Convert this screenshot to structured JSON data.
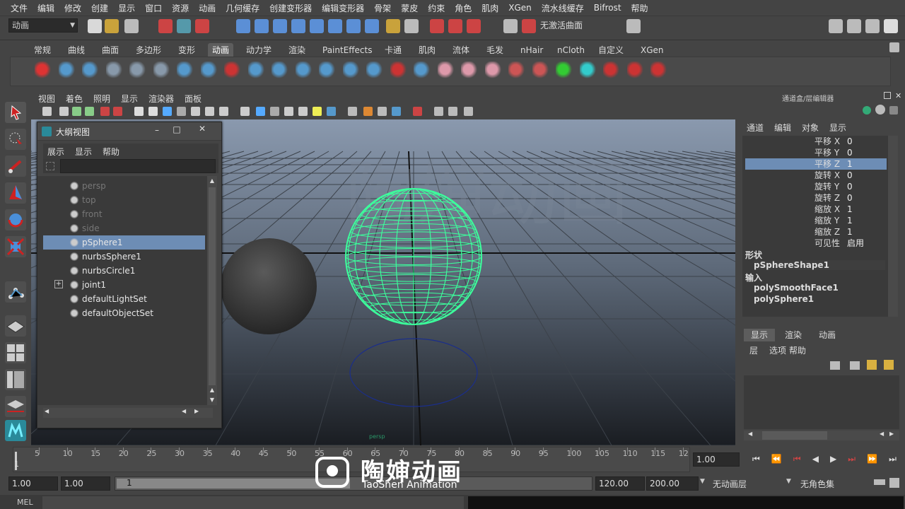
{
  "menubar": [
    "文件",
    "编辑",
    "修改",
    "创建",
    "显示",
    "窗口",
    "资源",
    "动画",
    "几何缓存",
    "创建变形器",
    "编辑变形器",
    "骨架",
    "蒙皮",
    "约束",
    "角色",
    "肌肉",
    "XGen",
    "流水线缓存",
    "Bifrost",
    "帮助"
  ],
  "status": {
    "mode": "动画",
    "live_surface": "无激活曲面"
  },
  "shelf_tabs": [
    "常规",
    "曲线",
    "曲面",
    "多边形",
    "变形",
    "动画",
    "动力学",
    "渲染",
    "PaintEffects",
    "卡通",
    "肌肉",
    "流体",
    "毛发",
    "nHair",
    "nCloth",
    "自定义",
    "XGen"
  ],
  "shelf_active": "动画",
  "viewport": {
    "menus": [
      "视图",
      "着色",
      "照明",
      "显示",
      "渲染器",
      "面板"
    ],
    "camera_label": "persp",
    "watermark": "陶婶动画"
  },
  "outliner": {
    "title": "大纲视图",
    "menus": [
      "展示",
      "显示",
      "帮助"
    ],
    "items": [
      {
        "name": "persp",
        "icon": "camera-icon",
        "dim": true
      },
      {
        "name": "top",
        "icon": "camera-icon",
        "dim": true
      },
      {
        "name": "front",
        "icon": "camera-icon",
        "dim": true
      },
      {
        "name": "side",
        "icon": "camera-icon",
        "dim": true
      },
      {
        "name": "pSphere1",
        "icon": "poly-mesh-icon",
        "selected": true
      },
      {
        "name": "nurbsSphere1",
        "icon": "nurbs-surface-icon"
      },
      {
        "name": "nurbsCircle1",
        "icon": "nurbs-curve-icon"
      },
      {
        "name": "joint1",
        "icon": "joint-icon",
        "expandable": true
      },
      {
        "name": "defaultLightSet",
        "icon": "set-icon"
      },
      {
        "name": "defaultObjectSet",
        "icon": "set-icon"
      }
    ]
  },
  "channel_box": {
    "title": "通道盒/层编辑器",
    "menus": [
      "通道",
      "编辑",
      "对象",
      "显示"
    ],
    "attributes": [
      {
        "name": "平移 X",
        "value": "0"
      },
      {
        "name": "平移 Y",
        "value": "0"
      },
      {
        "name": "平移 Z",
        "value": "1",
        "selected": true
      },
      {
        "name": "旋转 X",
        "value": "0"
      },
      {
        "name": "旋转 Y",
        "value": "0"
      },
      {
        "name": "旋转 Z",
        "value": "0"
      },
      {
        "name": "缩放 X",
        "value": "1"
      },
      {
        "name": "缩放 Y",
        "value": "1"
      },
      {
        "name": "缩放 Z",
        "value": "1"
      },
      {
        "name": "可见性",
        "value": "启用"
      }
    ],
    "shapes_header": "形状",
    "shape": "pSphereShape1",
    "inputs_header": "输入",
    "inputs": [
      "polySmoothFace1",
      "polySphere1"
    ]
  },
  "layer_editor": {
    "tabs": [
      "显示",
      "渲染",
      "动画"
    ],
    "menus": [
      "层",
      "选项",
      "帮助"
    ]
  },
  "timeline": {
    "ticks": [
      "5",
      "10",
      "15",
      "20",
      "25",
      "30",
      "35",
      "40",
      "45",
      "50",
      "55",
      "60",
      "65",
      "70",
      "75",
      "80",
      "85",
      "90",
      "95",
      "100",
      "105",
      "110",
      "115",
      "12"
    ],
    "current_frame": "1",
    "current_field": "1.00"
  },
  "range": {
    "start": "1.00",
    "playback_start": "1.00",
    "slider_value": "1",
    "playback_end": "120.00",
    "end": "200.00",
    "anim_layer": "无动画层",
    "char_set": "无角色集"
  },
  "mel": {
    "label": "MEL"
  },
  "brand": {
    "name": "陶婶动画",
    "sub": "TaoShen Animation"
  },
  "colors": {
    "selected": "#6d8db5",
    "wire": "#3cff9c",
    "accent": "#b33"
  }
}
